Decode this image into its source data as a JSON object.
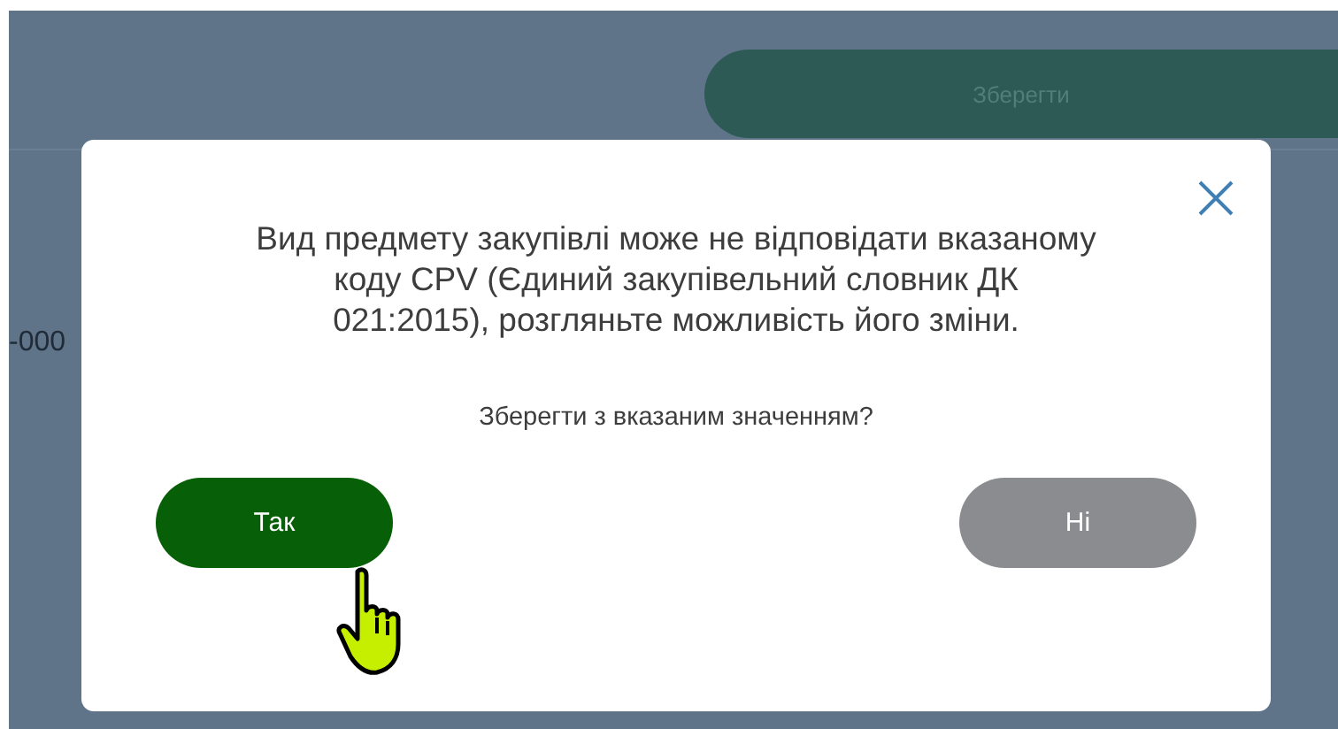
{
  "background": {
    "save_button": "Зберегти",
    "field_fragment": "-000"
  },
  "dialog": {
    "message": "Вид предмету закупівлі може не відповідати вказаному коду CPV (Єдиний закупівельний словник ДК 021:2015), розгляньте можливість його зміни.",
    "question": "Зберегти з вказаним значенням?",
    "buttons": [
      {
        "label": "Так",
        "kind": "primary"
      },
      {
        "label": "Ні",
        "kind": "secondary"
      }
    ]
  }
}
